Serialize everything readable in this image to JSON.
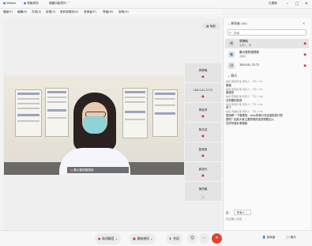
{
  "titlebar": {
    "app_label": "Webex",
    "meeting_label": "會議資訊",
    "host_label": "隱藏功能表列",
    "user_label": "已連線",
    "controls": {
      "minimize": "–",
      "maximize": "□",
      "close": "✕"
    }
  },
  "menubar": {
    "items": [
      "檔案(F)",
      "編輯(E)",
      "共用(S)",
      "檢視(V)",
      "音訊和視訊(A)",
      "參與者(P)",
      "會議(M)",
      "說明(H)"
    ]
  },
  "main": {
    "layout_button": "版面"
  },
  "video": {
    "name_label": "義大醫院護理部"
  },
  "tiles": [
    {
      "name": "周靜儀"
    },
    {
      "name": "184.041.3172"
    },
    {
      "name": "黃鈺萍"
    },
    {
      "name": "蔡佳容"
    },
    {
      "name": "藍雅惠"
    },
    {
      "name": "鄭淑玲"
    },
    {
      "name": "陳思穎"
    }
  ],
  "tiles_more": "⌄",
  "participants": {
    "title": "參與者 (34)",
    "search_placeholder": "搜尋",
    "items": [
      {
        "avatar": "周",
        "name": "周靜儀",
        "role": "主持人，我",
        "muted": true
      },
      {
        "avatar": "義",
        "name": "義大醫院護理部",
        "role": "主講人",
        "muted": true
      },
      {
        "avatar": "18",
        "name": "184.041.3172",
        "role": "",
        "muted": true
      }
    ]
  },
  "chat": {
    "title": "聊天",
    "messages": [
      {
        "meta": "來自 黃鈺萍 致 所有人：下午 1:57",
        "text": "謝謝"
      },
      {
        "meta": "來自 蔡佳容 致 所有人：下午 1:57",
        "text": "謝謝您"
      },
      {
        "meta": "來自 藍雅惠 致 所有人：下午 1:58",
        "text": "沒有聽到聲音"
      },
      {
        "meta": "來自 鄭淑玲 致 所有人：下午 1:59",
        "text": "有了"
      },
      {
        "meta": "來自 周靜儀 致 所有人：下午 2:00",
        "text": "想請教一下護理長，plan的執行內容重點是什麼"
      },
      {
        "meta": "",
        "text": "麼呢？因為大家主要是想把這些經驗加入"
      },
      {
        "meta": "",
        "text": "在的年度計畫裡面"
      }
    ],
    "to_label": "至：",
    "to_value": "所有人",
    "input_placeholder": "在此輸入訊息"
  },
  "controls": {
    "unmute": "取消靜音",
    "start_video": "開始視訊",
    "share": "共用",
    "reactions": "☺",
    "more": "···",
    "leave": "✕",
    "participants_btn": "參與者",
    "chat_btn": "聊天"
  },
  "colors": {
    "mute_red": "#d9342b",
    "leave_red": "#e0432f"
  }
}
